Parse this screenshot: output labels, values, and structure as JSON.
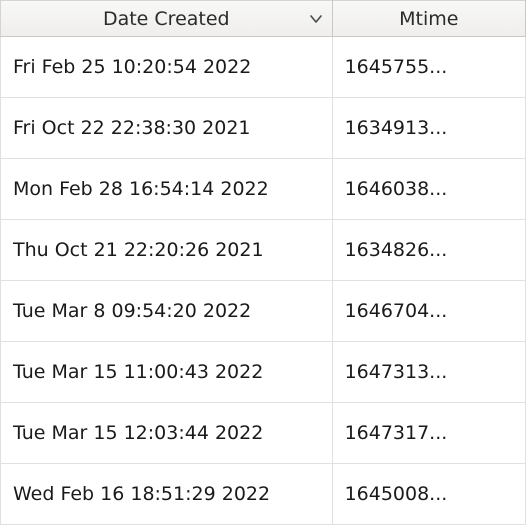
{
  "columns": {
    "date_created": {
      "label": "Date Created",
      "sorted": true
    },
    "mtime": {
      "label": "Mtime",
      "sorted": false
    }
  },
  "rows": [
    {
      "date_created": "Fri Feb 25 10:20:54 2022",
      "mtime": "1645755..."
    },
    {
      "date_created": "Fri Oct 22 22:38:30 2021",
      "mtime": "1634913..."
    },
    {
      "date_created": "Mon Feb 28 16:54:14 2022",
      "mtime": "1646038..."
    },
    {
      "date_created": "Thu Oct 21 22:20:26 2021",
      "mtime": "1634826..."
    },
    {
      "date_created": "Tue Mar  8 09:54:20 2022",
      "mtime": "1646704..."
    },
    {
      "date_created": "Tue Mar 15 11:00:43 2022",
      "mtime": "1647313..."
    },
    {
      "date_created": "Tue Mar 15 12:03:44 2022",
      "mtime": "1647317..."
    },
    {
      "date_created": "Wed Feb 16 18:51:29 2022",
      "mtime": "1645008..."
    }
  ]
}
